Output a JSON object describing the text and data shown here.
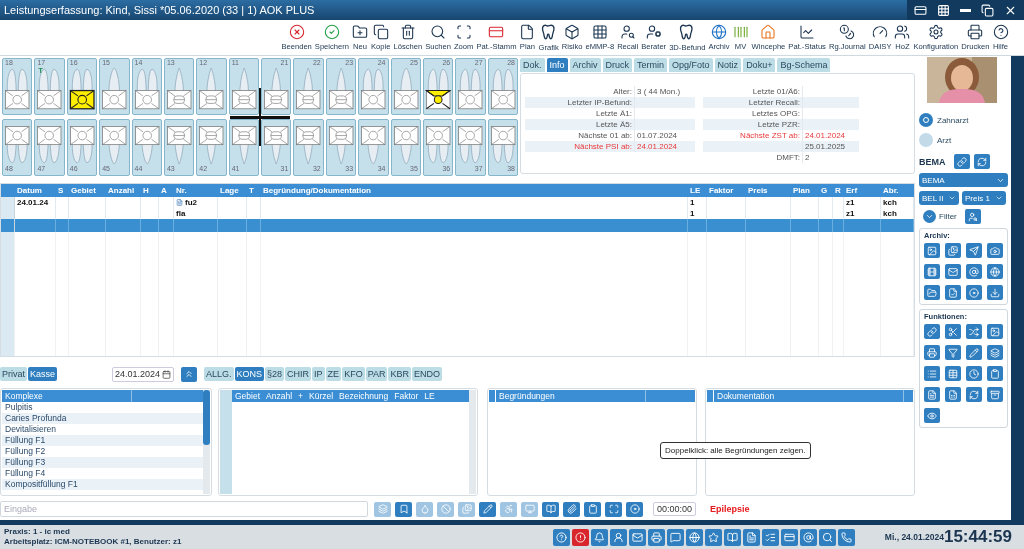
{
  "window": {
    "title": "Leistungserfassung: Kind, Sissi *05.06.2020 (33 | 1) AOK PLUS"
  },
  "toolbar": [
    {
      "label": "Beenden"
    },
    {
      "label": "Speichern"
    },
    {
      "label": "Neu"
    },
    {
      "label": "Kopie"
    },
    {
      "label": "Löschen"
    },
    {
      "label": "Suchen"
    },
    {
      "label": "Zoom"
    },
    {
      "label": "Pat.-Stamm"
    },
    {
      "label": "Plan"
    },
    {
      "label": "Grafik"
    },
    {
      "label": "Risiko"
    },
    {
      "label": "eMMP-8"
    },
    {
      "label": "Recall"
    },
    {
      "label": "Berater"
    },
    {
      "label": "3D-Befund"
    },
    {
      "label": "Archiv"
    },
    {
      "label": "MV"
    },
    {
      "label": "Wincephe"
    },
    {
      "label": "Pat.-Status"
    },
    {
      "label": "Rg.Journal"
    },
    {
      "label": "DAISY"
    },
    {
      "label": "HoZ"
    },
    {
      "label": "Konfiguration"
    },
    {
      "label": "Drucken"
    },
    {
      "label": "Hilfe"
    }
  ],
  "teeth": {
    "upper": [
      {
        "number": "18",
        "kind": "molar",
        "filled": false,
        "partly_filled": false
      },
      {
        "number": "17",
        "kind": "molar",
        "filled": false,
        "partly_filled": false,
        "marker": "T"
      },
      {
        "number": "16",
        "kind": "molar",
        "filled": true,
        "partly_filled": false
      },
      {
        "number": "15",
        "kind": "premolar",
        "filled": false,
        "partly_filled": false
      },
      {
        "number": "14",
        "kind": "molar",
        "filled": false,
        "partly_filled": false
      },
      {
        "number": "13",
        "kind": "front",
        "filled": false,
        "partly_filled": false
      },
      {
        "number": "12",
        "kind": "front",
        "filled": false,
        "partly_filled": false
      },
      {
        "number": "11",
        "kind": "front",
        "filled": false,
        "partly_filled": false
      },
      {
        "number": "21",
        "kind": "front",
        "filled": false,
        "partly_filled": false
      },
      {
        "number": "22",
        "kind": "front",
        "filled": false,
        "partly_filled": false
      },
      {
        "number": "23",
        "kind": "front",
        "filled": false,
        "partly_filled": false
      },
      {
        "number": "24",
        "kind": "molar",
        "filled": false,
        "partly_filled": false
      },
      {
        "number": "25",
        "kind": "premolar",
        "filled": false,
        "partly_filled": false
      },
      {
        "number": "26",
        "kind": "molar",
        "filled": false,
        "partly_filled": true
      },
      {
        "number": "27",
        "kind": "molar",
        "filled": false,
        "partly_filled": false
      },
      {
        "number": "28",
        "kind": "molar",
        "filled": false,
        "partly_filled": false
      }
    ],
    "lower": [
      {
        "number": "48",
        "kind": "molar",
        "filled": false,
        "partly_filled": false
      },
      {
        "number": "47",
        "kind": "molar",
        "filled": false,
        "partly_filled": false
      },
      {
        "number": "46",
        "kind": "molar",
        "filled": false,
        "partly_filled": false
      },
      {
        "number": "45",
        "kind": "premolar",
        "filled": false,
        "partly_filled": false
      },
      {
        "number": "44",
        "kind": "premolar",
        "filled": false,
        "partly_filled": false
      },
      {
        "number": "43",
        "kind": "front",
        "filled": false,
        "partly_filled": false
      },
      {
        "number": "42",
        "kind": "front",
        "filled": false,
        "partly_filled": false
      },
      {
        "number": "41",
        "kind": "front",
        "filled": false,
        "partly_filled": false
      },
      {
        "number": "31",
        "kind": "front",
        "filled": false,
        "partly_filled": false
      },
      {
        "number": "32",
        "kind": "front",
        "filled": false,
        "partly_filled": false
      },
      {
        "number": "33",
        "kind": "front",
        "filled": false,
        "partly_filled": false
      },
      {
        "number": "34",
        "kind": "premolar",
        "filled": false,
        "partly_filled": false
      },
      {
        "number": "35",
        "kind": "premolar",
        "filled": false,
        "partly_filled": false
      },
      {
        "number": "36",
        "kind": "molar",
        "filled": false,
        "partly_filled": false
      },
      {
        "number": "37",
        "kind": "molar",
        "filled": false,
        "partly_filled": false
      },
      {
        "number": "38",
        "kind": "molar",
        "filled": false,
        "partly_filled": false
      }
    ]
  },
  "tabs": [
    {
      "label": "Dok.",
      "selected": false
    },
    {
      "label": "Info",
      "selected": true
    },
    {
      "label": "Archiv",
      "selected": false
    },
    {
      "label": "Druck",
      "selected": false
    },
    {
      "label": "Termin",
      "selected": false
    },
    {
      "label": "Opg/Foto",
      "selected": false
    },
    {
      "label": "Notiz",
      "selected": false
    },
    {
      "label": "Doku+",
      "selected": false
    },
    {
      "label": "Bg-Schema",
      "selected": false
    }
  ],
  "info": {
    "left": [
      {
        "label": "Alter:",
        "value": "3 (  44 Mon.)",
        "alert": false
      },
      {
        "label": "Letzter IP-Befund:",
        "alert": false
      },
      {
        "label": "Letzte Ä1:",
        "alert": false
      },
      {
        "label": "Letzte Ä5:",
        "alert": false
      },
      {
        "label": "Nächste 01 ab:",
        "value": "01.07.2024",
        "alert": false
      },
      {
        "label": "Nächste PSI ab:",
        "value": "24.01.2024",
        "alert": true
      }
    ],
    "right": [
      {
        "label": "Letzte 01/Ä6:",
        "alert": false
      },
      {
        "label": "Letzter Recall:",
        "alert": false
      },
      {
        "label": "Letztes OPG:",
        "alert": false
      },
      {
        "label": "Letzte PZR:",
        "alert": false
      },
      {
        "label": "Nächste ZST ab:",
        "value": "24.01.2024",
        "alert": true
      },
      {
        "value": "25.01.2025",
        "alert": false
      },
      {
        "label": "DMFT:",
        "value": "2",
        "alert": false
      }
    ]
  },
  "provider": [
    {
      "label": "Zahnarzt",
      "selected": true
    },
    {
      "label": "Arzt",
      "selected": false
    }
  ],
  "catalog": {
    "label": "BEMA",
    "select": "BEMA",
    "level_select": "BEL II",
    "price_select": "Preis 1",
    "filter": "Filter"
  },
  "archive": {
    "title": "Archiv:"
  },
  "functions": {
    "title": "Funktionen:"
  },
  "table": {
    "columns": [
      "Datum",
      "S",
      "Gebiet",
      "Anzahl",
      "H",
      "A",
      "Nr.",
      "Lage",
      "T",
      "Begründung/Dokumentation",
      "LE",
      "Faktor",
      "Preis",
      "Plan",
      "G",
      "R",
      "Erf",
      "Abr."
    ],
    "rows": [
      {
        "selected": false,
        "note_icon": true,
        "cells": [
          "24.01.24",
          null,
          null,
          null,
          null,
          null,
          "fu2",
          null,
          null,
          null,
          "1",
          null,
          null,
          null,
          null,
          null,
          "z1",
          "kch"
        ]
      },
      {
        "selected": false,
        "note_icon": false,
        "cells": [
          null,
          null,
          null,
          null,
          null,
          null,
          "fla",
          null,
          null,
          null,
          "1",
          null,
          null,
          null,
          null,
          null,
          "z1",
          "kch"
        ]
      },
      {
        "selected": true,
        "note_icon": false
      }
    ]
  },
  "billing_tabs": [
    {
      "label": "Privat",
      "selected": false
    },
    {
      "label": "Kasse",
      "selected": true
    }
  ],
  "date": "24.01.2024",
  "categories": [
    {
      "label": "ALLG.",
      "selected": false
    },
    {
      "label": "KONS",
      "selected": true
    },
    {
      "label": "§28",
      "selected": false
    },
    {
      "label": "CHIR",
      "selected": false
    },
    {
      "label": "IP",
      "selected": false
    },
    {
      "label": "ZE",
      "selected": false
    },
    {
      "label": "KFO",
      "selected": false
    },
    {
      "label": "PAR",
      "selected": false
    },
    {
      "label": "KBR",
      "selected": false
    },
    {
      "label": "ENDO",
      "selected": false
    }
  ],
  "complexes": {
    "header": "Komplexe",
    "items": [
      "Pulpitis",
      "Caries Profunda",
      "Devitalisieren",
      "Füllung F1",
      "Füllung F2",
      "Füllung F3",
      "Füllung F4",
      "Kompositfüllung F1"
    ]
  },
  "services": {
    "columns": [
      "Gebiet",
      "Anzahl",
      "+",
      "Kürzel",
      "Bezeichnung",
      "Faktor",
      "LE"
    ]
  },
  "reasons": {
    "header": "Begründungen"
  },
  "documentation": {
    "header": "Dokumentation"
  },
  "tooltip": "Doppelklick: alle Begründungen zeigen.",
  "input": {
    "placeholder": "Eingabe",
    "tools": [
      {
        "disabled": true
      },
      {
        "disabled": false
      },
      {
        "disabled": true
      },
      {
        "disabled": true
      },
      {
        "disabled": true
      },
      {
        "disabled": false
      },
      {
        "disabled": true
      },
      {
        "disabled": true
      },
      {
        "disabled": false
      },
      {
        "disabled": false
      },
      {
        "disabled": false
      },
      {
        "disabled": false
      },
      {
        "disabled": false
      }
    ],
    "timer": "00:00:00",
    "alert": "Epilepsie"
  },
  "status_bar": {
    "practice": "Praxis:  1 - ic med",
    "workstation": "Arbeitsplatz: ICM-NOTEBOOK #1, Benutzer: z1",
    "date": "Mi., 24.01.2024",
    "time": "15:44:59"
  }
}
